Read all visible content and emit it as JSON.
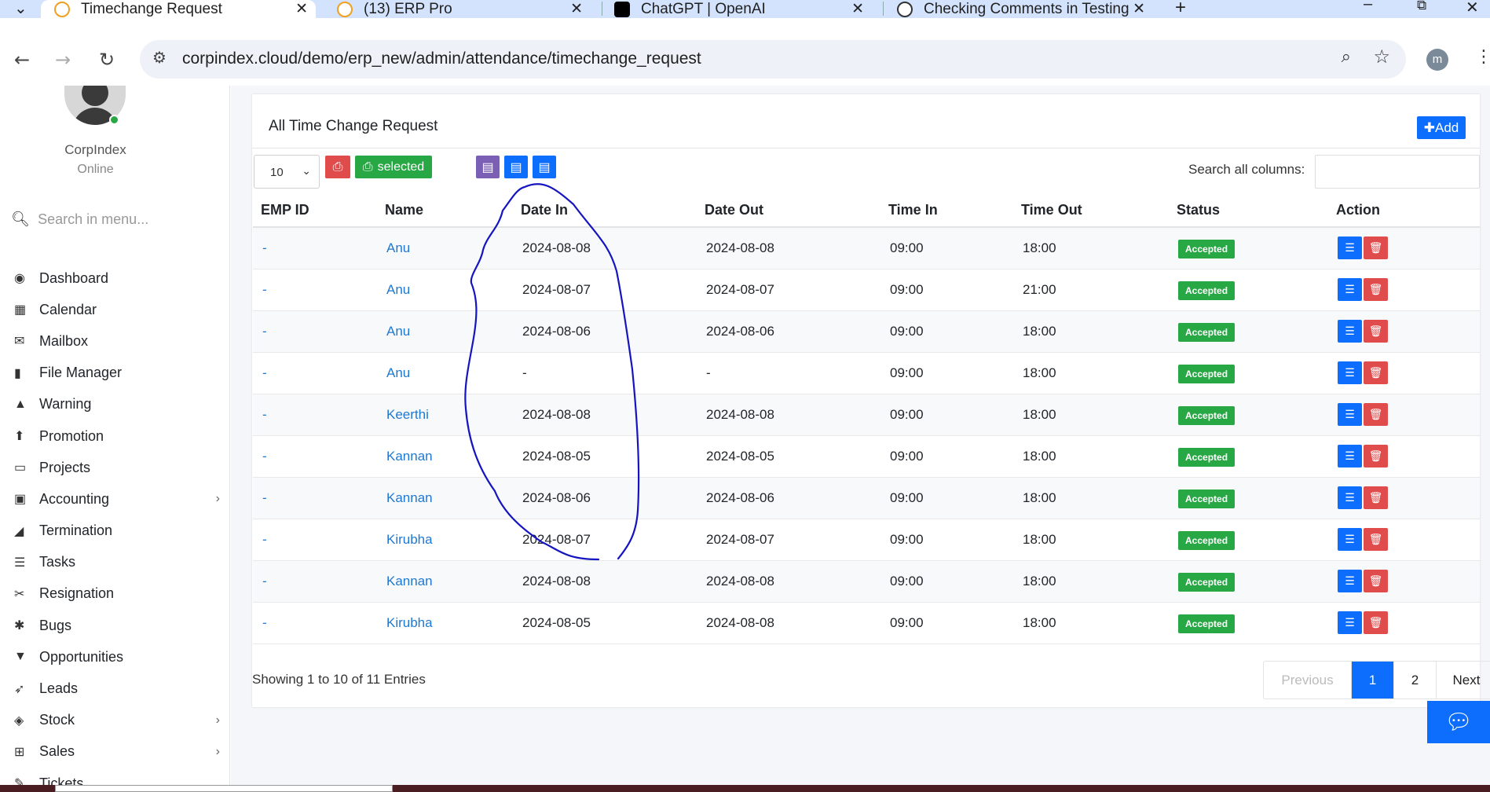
{
  "browser": {
    "tabs": [
      {
        "title": "Timechange Request",
        "active": true
      },
      {
        "title": "(13) ERP Pro",
        "active": false
      },
      {
        "title": "ChatGPT | OpenAI",
        "active": false
      },
      {
        "title": "Checking Comments in Testing",
        "active": false
      }
    ],
    "url": "corpindex.cloud/demo/erp_new/admin/attendance/timechange_request",
    "profile_initial": "m"
  },
  "sidebar": {
    "user_name": "CorpIndex",
    "user_status": "Online",
    "search_placeholder": "Search in menu...",
    "items": [
      {
        "label": "Dashboard",
        "icon": "dashboard-icon",
        "glyph": "◉"
      },
      {
        "label": "Calendar",
        "icon": "calendar-icon",
        "glyph": "▦"
      },
      {
        "label": "Mailbox",
        "icon": "mail-icon",
        "glyph": "✉"
      },
      {
        "label": "File Manager",
        "icon": "file-icon",
        "glyph": "▮"
      },
      {
        "label": "Warning",
        "icon": "warning-icon",
        "glyph": "▲"
      },
      {
        "label": "Promotion",
        "icon": "promotion-icon",
        "glyph": "⬆"
      },
      {
        "label": "Projects",
        "icon": "folder-icon",
        "glyph": "▭"
      },
      {
        "label": "Accounting",
        "icon": "money-icon",
        "glyph": "▣",
        "has_children": true
      },
      {
        "label": "Termination",
        "icon": "eraser-icon",
        "glyph": "◢"
      },
      {
        "label": "Tasks",
        "icon": "tasks-icon",
        "glyph": "☰"
      },
      {
        "label": "Resignation",
        "icon": "scissors-icon",
        "glyph": "✂"
      },
      {
        "label": "Bugs",
        "icon": "bug-icon",
        "glyph": "✱"
      },
      {
        "label": "Opportunities",
        "icon": "filter-icon",
        "glyph": "▼"
      },
      {
        "label": "Leads",
        "icon": "rocket-icon",
        "glyph": "➶"
      },
      {
        "label": "Stock",
        "icon": "layers-icon",
        "glyph": "◈",
        "has_children": true
      },
      {
        "label": "Sales",
        "icon": "cart-icon",
        "glyph": "⊞",
        "has_children": true
      },
      {
        "label": "Tickets",
        "icon": "ticket-icon",
        "glyph": "✎"
      }
    ]
  },
  "card": {
    "title": "All Time Change Request",
    "add_label": "Add",
    "page_length": "10",
    "selected_label": "selected",
    "search_label": "Search all columns:",
    "columns": [
      "EMP ID",
      "Name",
      "Date In",
      "Date Out",
      "Time In",
      "Time Out",
      "Status",
      "Action"
    ],
    "rows": [
      {
        "emp": "-",
        "name": "Anu",
        "date_in": "2024-08-08",
        "date_out": "2024-08-08",
        "time_in": "09:00",
        "time_out": "18:00",
        "status": "Accepted"
      },
      {
        "emp": "-",
        "name": "Anu",
        "date_in": "2024-08-07",
        "date_out": "2024-08-07",
        "time_in": "09:00",
        "time_out": "21:00",
        "status": "Accepted"
      },
      {
        "emp": "-",
        "name": "Anu",
        "date_in": "2024-08-06",
        "date_out": "2024-08-06",
        "time_in": "09:00",
        "time_out": "18:00",
        "status": "Accepted"
      },
      {
        "emp": "-",
        "name": "Anu",
        "date_in": "-",
        "date_out": "-",
        "time_in": "09:00",
        "time_out": "18:00",
        "status": "Accepted"
      },
      {
        "emp": "-",
        "name": "Keerthi",
        "date_in": "2024-08-08",
        "date_out": "2024-08-08",
        "time_in": "09:00",
        "time_out": "18:00",
        "status": "Accepted"
      },
      {
        "emp": "-",
        "name": "Kannan",
        "date_in": "2024-08-05",
        "date_out": "2024-08-05",
        "time_in": "09:00",
        "time_out": "18:00",
        "status": "Accepted"
      },
      {
        "emp": "-",
        "name": "Kannan",
        "date_in": "2024-08-06",
        "date_out": "2024-08-06",
        "time_in": "09:00",
        "time_out": "18:00",
        "status": "Accepted"
      },
      {
        "emp": "-",
        "name": "Kirubha",
        "date_in": "2024-08-07",
        "date_out": "2024-08-07",
        "time_in": "09:00",
        "time_out": "18:00",
        "status": "Accepted"
      },
      {
        "emp": "-",
        "name": "Kannan",
        "date_in": "2024-08-08",
        "date_out": "2024-08-08",
        "time_in": "09:00",
        "time_out": "18:00",
        "status": "Accepted"
      },
      {
        "emp": "-",
        "name": "Kirubha",
        "date_in": "2024-08-05",
        "date_out": "2024-08-08",
        "time_in": "09:00",
        "time_out": "18:00",
        "status": "Accepted"
      }
    ],
    "info": "Showing 1 to 10 of 11 Entries",
    "pagination": {
      "previous": "Previous",
      "pages": [
        "1",
        "2"
      ],
      "current": "1",
      "next": "Next"
    }
  },
  "colors": {
    "primary": "#0d6efd",
    "success": "#28a745",
    "danger": "#e04b4b",
    "excel": "#7b5fb5",
    "annotation": "#1515c0"
  }
}
